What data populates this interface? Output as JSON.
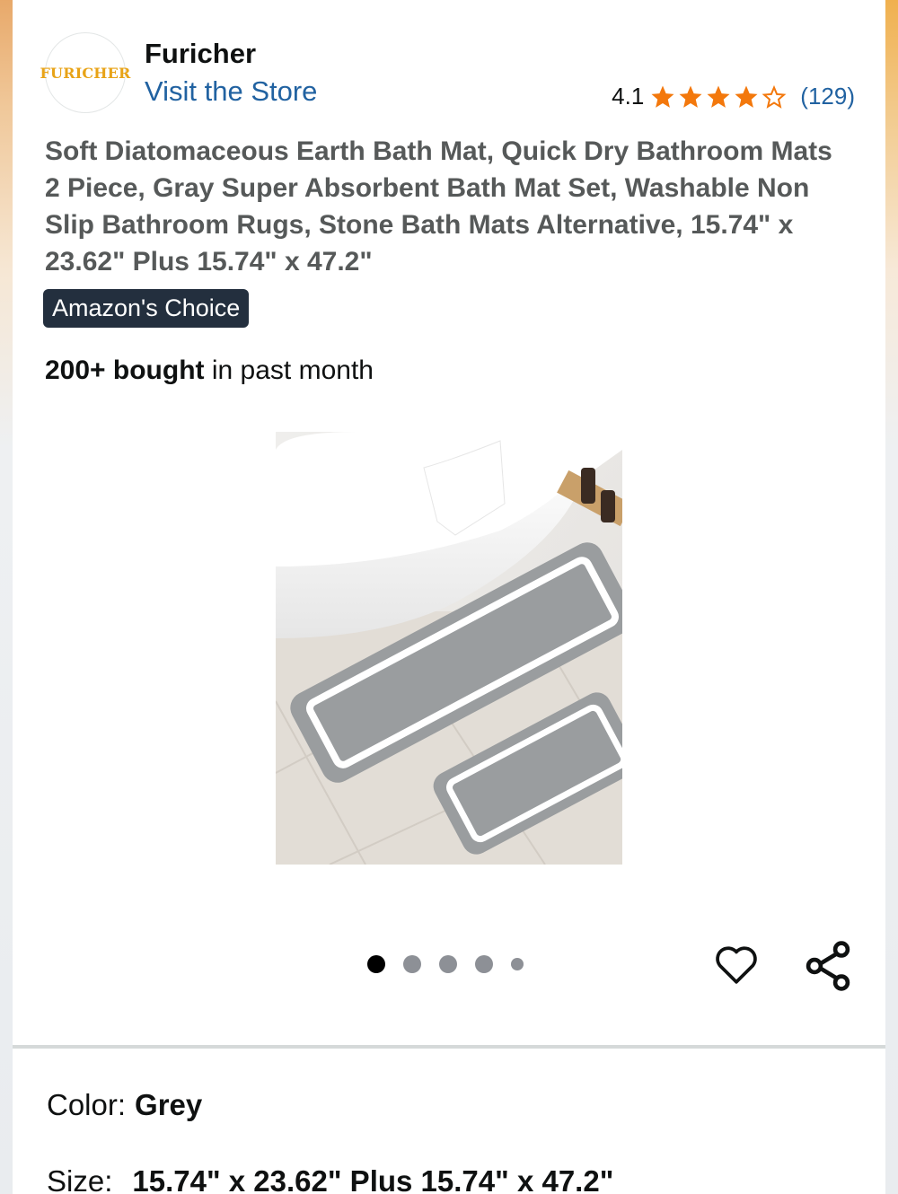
{
  "store": {
    "logo_text": "FURICHER",
    "brand_name": "Furicher",
    "visit_store_label": "Visit the Store"
  },
  "rating": {
    "value": "4.1",
    "stars_filled": 4,
    "stars_total": 5,
    "review_count": "(129)",
    "star_color": "#f3780c"
  },
  "product": {
    "title": "Soft Diatomaceous Earth Bath Mat, Quick Dry Bathroom Mats 2 Piece, Gray Super Absorbent Bath Mat Set, Washable Non Slip Bathroom Rugs, Stone Bath Mats Alternative, 15.74\" x 23.62\" Plus 15.74\" x 47.2\"",
    "badge": "Amazon's Choice",
    "bought_bold": "200+ bought",
    "bought_rest": " in past month"
  },
  "carousel": {
    "image_count": 5,
    "active_index": 0
  },
  "actions": {
    "wishlist_icon": "heart-outline-icon",
    "share_icon": "share-icon"
  },
  "variations": {
    "color_label": "Color:",
    "color_value": "Grey",
    "size_label": "Size:",
    "size_value": "15.74\" x 23.62\" Plus 15.74\" x 47.2\""
  },
  "colors": {
    "link": "#2162a1",
    "badge_bg": "#232f3e",
    "title_text": "#565959"
  }
}
